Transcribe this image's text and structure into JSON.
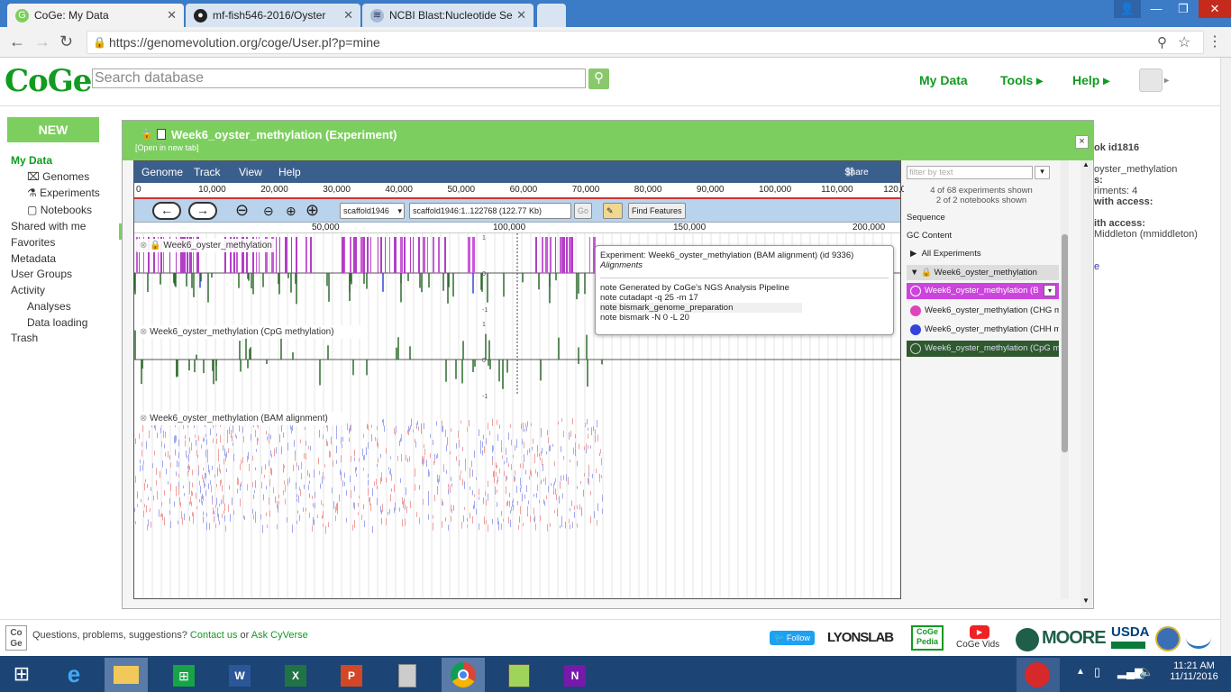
{
  "browser": {
    "tabs": [
      {
        "label": "CoGe: My Data",
        "icon": "coge-favicon"
      },
      {
        "label": "mf-fish546-2016/Oyster",
        "icon": "github-icon"
      },
      {
        "label": "NCBI Blast:Nucleotide Se",
        "icon": "ncbi-icon"
      }
    ],
    "url": "https://genomevolution.org/coge/User.pl?p=mine"
  },
  "header": {
    "logo": "CoGe",
    "search_placeholder": "Search database",
    "nav": [
      "My Data",
      "Tools",
      "Help"
    ]
  },
  "leftnav": {
    "new_label": "NEW",
    "my_data": "My Data",
    "items": [
      "Genomes",
      "Experiments",
      "Notebooks"
    ],
    "shared": "Shared with me",
    "favorites": "Favorites",
    "metadata": "Metadata",
    "user_groups": "User Groups",
    "activity": "Activity",
    "analyses": "Analyses",
    "data_loading": "Data loading",
    "trash": "Trash"
  },
  "behind": {
    "line1": "ok id1816",
    "line2": "oyster_methylation",
    "line3": "s:",
    "line4": "riments: 4",
    "line5": "with access:",
    "line6": "ith access:",
    "line7": "Middleton (mmiddleton)",
    "line8": "e"
  },
  "modal": {
    "title": "Week6_oyster_methylation (Experiment)",
    "open_link": "[Open in new tab]",
    "close": "×"
  },
  "jbrowse": {
    "menu": [
      "Genome",
      "Track",
      "View",
      "Help"
    ],
    "share": "Share",
    "ruler_ticks": [
      "0",
      "10,000",
      "20,000",
      "30,000",
      "40,000",
      "50,000",
      "60,000",
      "70,000",
      "80,000",
      "90,000",
      "100,000",
      "110,000",
      "120,000"
    ],
    "scaffold": "scaffold1946",
    "location": "scaffold1946:1..122768 (122.77 Kb)",
    "go": "Go",
    "find_features": "Find Features",
    "detail_ticks": [
      "50,000",
      "100,000",
      "150,000",
      "200,000"
    ],
    "tracks": [
      "Week6_oyster_methylation",
      "Week6_oyster_methylation (CpG methylation)",
      "Week6_oyster_methylation (BAM alignment)"
    ],
    "scale_labels": [
      "1",
      "0",
      "-1"
    ]
  },
  "tooltip": {
    "title": "Experiment: Week6_oyster_methylation (BAM alignment)",
    "id": "(id 9336)",
    "subtitle": "Alignments",
    "notes": [
      {
        "key": "note",
        "value": "Generated by CoGe's NGS Analysis Pipeline"
      },
      {
        "key": "note",
        "value": "cutadapt -q 25 -m 17"
      },
      {
        "key": "note",
        "value": "bismark_genome_preparation"
      },
      {
        "key": "note",
        "value": "bismark -N 0 -L 20"
      }
    ]
  },
  "sidebar": {
    "filter_placeholder": "filter by text",
    "count1": "4 of 68 experiments shown",
    "count2": "2 of 2 notebooks shown",
    "sequence": "Sequence",
    "gc_content": "GC Content",
    "all_experiments": "All Experiments",
    "notebook": "Week6_oyster_methylation",
    "experiments": [
      {
        "label": "Week6_oyster_methylation (B",
        "color": "#cc44dd"
      },
      {
        "label": "Week6_oyster_methylation (CHG m",
        "color": "#dd44bb"
      },
      {
        "label": "Week6_oyster_methylation (CHH m",
        "color": "#3344dd"
      },
      {
        "label": "Week6_oyster_methylation (CpG m",
        "color": "#2f5a2f"
      }
    ]
  },
  "footer": {
    "question": "Questions, problems, suggestions?",
    "contact": "Contact us",
    "or": "or",
    "ask": "Ask CyVerse",
    "follow": "Follow",
    "lyons": "LYONSLAB",
    "cogepedia": "CoGe Pedia",
    "cogevids": "CoGe Vids",
    "moore": "MOORE",
    "usda": "USDA"
  },
  "taskbar": {
    "time": "11:21 AM",
    "date": "11/11/2016"
  }
}
